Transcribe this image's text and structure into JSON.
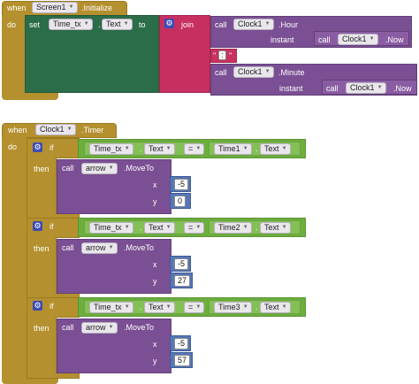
{
  "block1": {
    "when": "when",
    "component": "Screen1",
    "event": ".Initialize",
    "do": "do",
    "set": "set",
    "target_component": "Time_tx",
    "target_prop": "Text",
    "to": "to",
    "join": "join",
    "call": "call",
    "clock": "Clock1",
    "hour": ".Hour",
    "instant": "instant",
    "now": ".Now",
    "sep": "\" : \"",
    "sep_text": ":",
    "minute": ".Minute"
  },
  "block2": {
    "when": "when",
    "component": "Clock1",
    "event": ".Timer",
    "do": "do",
    "if": "if",
    "then": "then",
    "call": "call",
    "sprite": "arrow",
    "moveto": ".MoveTo",
    "x_label": "x",
    "y_label": "y",
    "lhs_comp": "Time_tx",
    "lhs_prop": "Text",
    "op": "=",
    "rhs_prop": "Text",
    "conds": [
      {
        "rhs_comp": "Time1",
        "x": "-5",
        "y": "0"
      },
      {
        "rhs_comp": "Time2",
        "x": "-5",
        "y": "27"
      },
      {
        "rhs_comp": "Time3",
        "x": "-5",
        "y": "57"
      }
    ]
  }
}
